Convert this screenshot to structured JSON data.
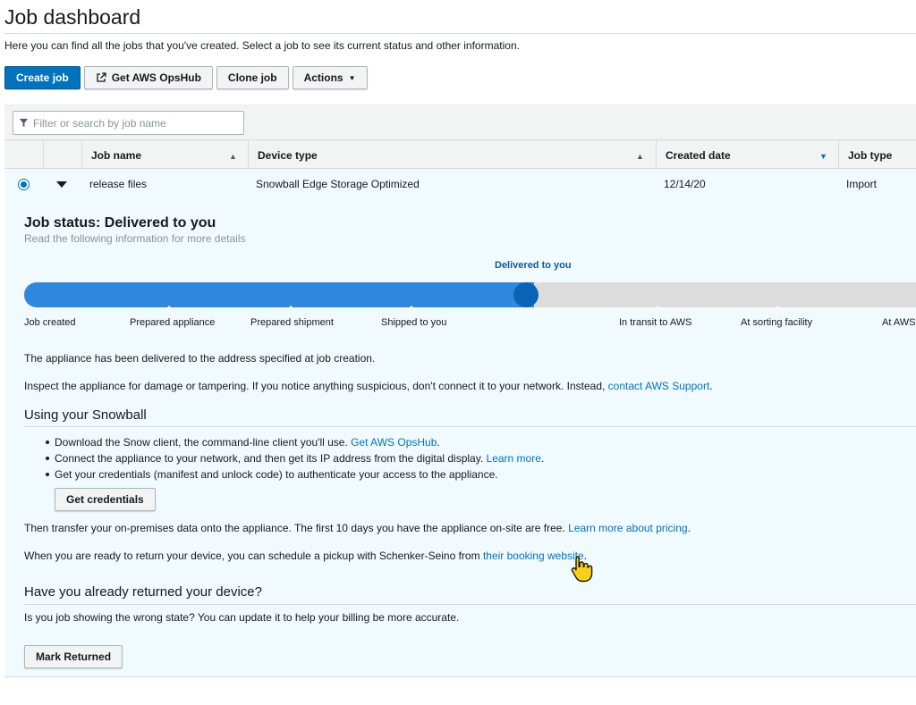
{
  "page": {
    "title": "Job dashboard",
    "intro": "Here you can find all the jobs that you've created. Select a job to see its current status and other information."
  },
  "toolbar": {
    "create_job": "Create job",
    "get_opshub": "Get AWS OpsHub",
    "clone_job": "Clone job",
    "actions": "Actions"
  },
  "search": {
    "placeholder": "Filter or search by job name"
  },
  "table": {
    "columns": [
      "Job name",
      "Device type",
      "Created date",
      "Job type"
    ],
    "rows": [
      {
        "job_name": "release files",
        "device_type": "Snowball Edge Storage Optimized",
        "created_date": "12/14/20",
        "job_type": "Import",
        "selected": true
      }
    ]
  },
  "job_status": {
    "title": "Job status: Delivered to you",
    "subtitle": "Read the following information for more details",
    "current_step": "Delivered to you",
    "steps": [
      "Job created",
      "Prepared appliance",
      "Prepared shipment",
      "Shipped to you",
      "In transit to AWS",
      "At sorting facility",
      "At AWS"
    ]
  },
  "content": {
    "delivered_text": "The appliance has been delivered to the address specified at job creation.",
    "inspect_text": "Inspect the appliance for damage or tampering. If you notice anything suspicious, don't connect it to your network. Instead, ",
    "inspect_link": "contact AWS Support",
    "using_heading": "Using your Snowball",
    "bullet1_text": "Download the Snow client, the command-line client you'll use. ",
    "bullet1_link": "Get AWS OpsHub",
    "bullet2_text": "Connect the appliance to your network, and then get its IP address from the digital display. ",
    "bullet2_link": "Learn more",
    "bullet3_text": "Get your credentials (manifest and unlock code) to authenticate your access to the appliance.",
    "get_credentials": "Get credentials",
    "transfer_text": "Then transfer your on-premises data onto the appliance. The first 10 days you have the appliance on-site are free. ",
    "transfer_link": "Learn more about pricing",
    "return_text": "When you are ready to return your device, you can schedule a pickup with Schenker-Seino from ",
    "return_link": "their booking website",
    "returned_heading": "Have you already returned your device?",
    "returned_text": "Is you job showing the wrong state? You can update it to help your billing be more accurate.",
    "mark_returned": "Mark Returned"
  },
  "colors": {
    "primary": "#0073bb",
    "progress": "#2f88de",
    "selected_row": "#f1faff"
  }
}
